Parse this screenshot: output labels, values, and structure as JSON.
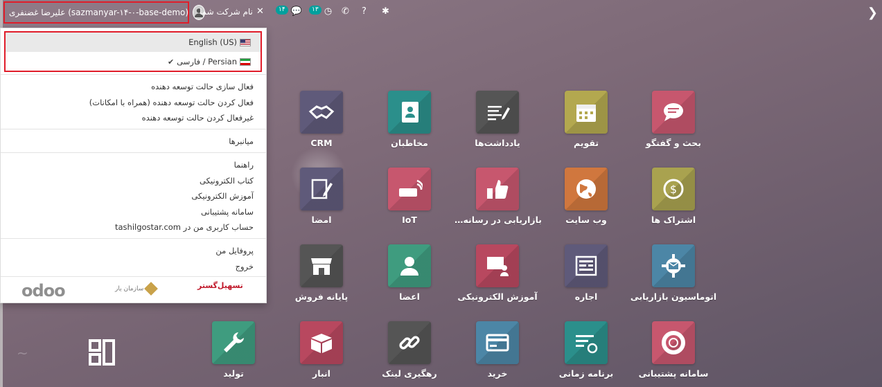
{
  "topbar": {
    "user_name": "علیرضا غضنفری (sazmanyar-۱۴-۰-base-demo)",
    "company_name": "نام شرکت شما",
    "messages_count": "۱۴",
    "activities_count": "۱۳"
  },
  "language_menu": [
    {
      "label": "English (US)",
      "flag": "us-flag",
      "active": true
    },
    {
      "label": "Persian / فارسی",
      "flag": "iran-flag",
      "checked": true
    }
  ],
  "developer_items": [
    "فعال سازی حالت توسعه دهنده",
    "فعال کردن حالت توسعه دهنده (همراه با امکانات)",
    "غیرفعال کردن حالت توسعه دهنده"
  ],
  "shortcuts_item": "میانبرها",
  "help_items": [
    "راهنما",
    "کتاب الکترونیکی",
    "آموزش الکترونیکی",
    "سامانه پشتیبانی",
    "حساب کاربری من در tashilgostar.com"
  ],
  "account_items": [
    "پروفایل من",
    "خروج"
  ],
  "logos": {
    "odoo": "odoo",
    "sazmanyar": "سازمان یار",
    "tashilgostar": "تسهیل‌گستر"
  },
  "apps": [
    {
      "label": "بحث و گفتگو",
      "color": "#c7576e",
      "icon": "chat-icon"
    },
    {
      "label": "تقویم",
      "color": "#b3a84f",
      "icon": "calendar-icon"
    },
    {
      "label": "یادداشت‌ها",
      "color": "#555555",
      "icon": "notes-icon"
    },
    {
      "label": "مخاطبان",
      "color": "#2b8f8b",
      "icon": "contacts-icon"
    },
    {
      "label": "CRM",
      "color": "#5f5a7a",
      "icon": "handshake-icon"
    },
    {
      "label": "اشتراک ها",
      "color": "#a9a24f",
      "icon": "subscription-icon"
    },
    {
      "label": "وب سایت",
      "color": "#d0773e",
      "icon": "globe-icon"
    },
    {
      "label": "بازاریابی در رسانه ها...",
      "color": "#c7576e",
      "icon": "thumbs-up-icon"
    },
    {
      "label": "IoT",
      "color": "#c7576e",
      "icon": "iot-icon"
    },
    {
      "label": "امضا",
      "color": "#5f5a7a",
      "icon": "sign-icon"
    },
    {
      "label": "اتوماسیون بازاریابی",
      "color": "#4c86a6",
      "icon": "gear-mail-icon"
    },
    {
      "label": "اجاره",
      "color": "#5f5a7a",
      "icon": "rental-icon"
    },
    {
      "label": "آموزش الکترونیکی",
      "color": "#b8485f",
      "icon": "elearning-icon"
    },
    {
      "label": "اعضا",
      "color": "#3f9c7f",
      "icon": "member-icon"
    },
    {
      "label": "پایانه فروش",
      "color": "#555555",
      "icon": "shop-icon"
    },
    {
      "label": "سامانه پشتیبانی",
      "color": "#c7576e",
      "icon": "lifebuoy-icon"
    },
    {
      "label": "برنامه زمانی",
      "color": "#2b8f8b",
      "icon": "planning-icon"
    },
    {
      "label": "خرید",
      "color": "#4c86a6",
      "icon": "purchase-icon"
    },
    {
      "label": "رهگیری لینک",
      "color": "#555555",
      "icon": "link-icon"
    },
    {
      "label": "انبار",
      "color": "#b8485f",
      "icon": "inventory-icon"
    },
    {
      "label": "تولید",
      "color": "#3f9c7f",
      "icon": "wrench-icon"
    }
  ]
}
